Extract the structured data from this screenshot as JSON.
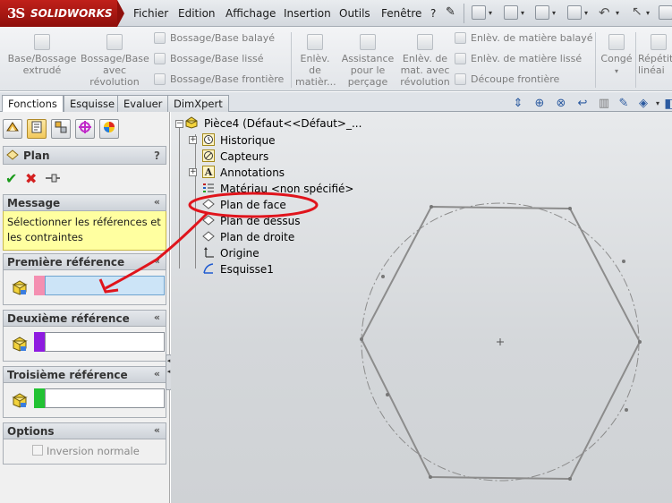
{
  "app": {
    "logo_ds": "3S",
    "logo_name": "SOLIDWORKS"
  },
  "menu": [
    "Fichier",
    "Edition",
    "Affichage",
    "Insertion",
    "Outils",
    "Fenêtre",
    "?"
  ],
  "commands": {
    "big": [
      {
        "label": "Base/Bossage extrudé",
        "line1": "Base/Bossage",
        "line2": "extrudé",
        "line3": ""
      },
      {
        "label": "Base/Bossage avec révolution",
        "line1": "Bossage/Base",
        "line2": "avec",
        "line3": "révolution"
      },
      {
        "label": "Enlèv. de matièr...",
        "line1": "Enlèv.",
        "line2": "de",
        "line3": "matièr..."
      },
      {
        "label": "Assistance pour le perçage",
        "line1": "Assistance",
        "line2": "pour le",
        "line3": "perçage"
      },
      {
        "label": "Enlèv. de mat. avec révolution",
        "line1": "Enlèv. de",
        "line2": "mat. avec",
        "line3": "révolution"
      },
      {
        "label": "Congé",
        "line1": "Congé",
        "line2": "",
        "line3": ""
      },
      {
        "label": "Répétition linéaire",
        "line1": "Répétiti",
        "line2": "linéai",
        "line3": ""
      }
    ],
    "small_left": [
      "Bossage/Base balayé",
      "Bossage/Base lissé",
      "Bossage/Base frontière"
    ],
    "small_right": [
      "Enlèv. de matière balayé",
      "Enlèv. de matière lissé",
      "Découpe frontière"
    ]
  },
  "tabs": [
    "Fonctions",
    "Esquisse",
    "Evaluer",
    "DimXpert"
  ],
  "property_manager": {
    "title": "Plan",
    "help": "?",
    "message_head": "Message",
    "message_text": "Sélectionner les références et les contraintes",
    "ref1": "Première référence",
    "ref2": "Deuxième référence",
    "ref3": "Troisième référence",
    "options": "Options",
    "inversion": "Inversion normale",
    "colors": {
      "ref1": "#f48fb1",
      "ref2": "#8e1be0",
      "ref3": "#22c233",
      "message_bg": "#ffffa0"
    }
  },
  "tree": {
    "root": "Pièce4 (Défaut<<Défaut>_...",
    "items": [
      "Historique",
      "Capteurs",
      "Annotations",
      "Matériau <non spécifié>",
      "Plan de face",
      "Plan de dessus",
      "Plan de droite",
      "Origine",
      "Esquisse1"
    ]
  },
  "annotation_color": "#e0141c"
}
